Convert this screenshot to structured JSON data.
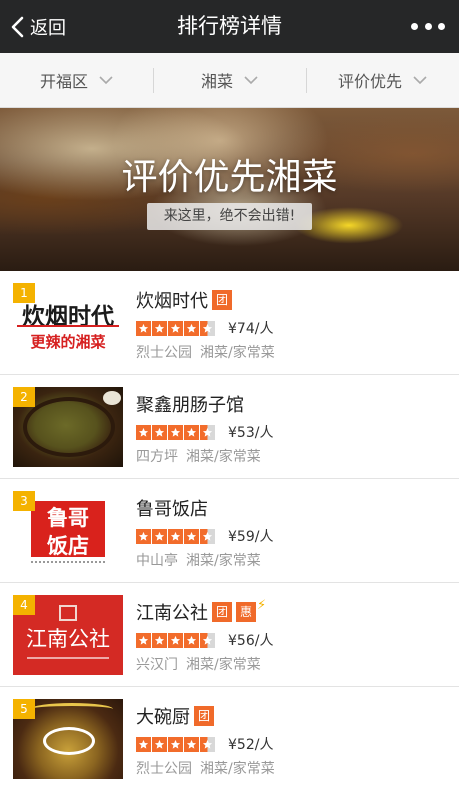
{
  "nav": {
    "back_label": "返回",
    "title": "排行榜详情"
  },
  "filters": [
    {
      "label": "开福区"
    },
    {
      "label": "湘菜"
    },
    {
      "label": "评价优先"
    }
  ],
  "banner": {
    "title": "评价优先湘菜",
    "subtitle": "来这里，绝不会出错!"
  },
  "restaurants": [
    {
      "rank": "1",
      "name": "炊烟时代",
      "tags": [
        "团"
      ],
      "rating": 4.5,
      "price": "¥74/人",
      "area": "烈士公园",
      "category": "湘菜/家常菜",
      "logo_text": [
        "炊烟时代",
        "更辣的湘菜"
      ]
    },
    {
      "rank": "2",
      "name": "聚鑫朋肠子馆",
      "tags": [],
      "rating": 4.5,
      "price": "¥53/人",
      "area": "四方坪",
      "category": "湘菜/家常菜",
      "logo_text": []
    },
    {
      "rank": "3",
      "name": "鲁哥饭店",
      "tags": [],
      "rating": 4.5,
      "price": "¥59/人",
      "area": "中山亭",
      "category": "湘菜/家常菜",
      "logo_text": [
        "鲁哥",
        "饭店"
      ]
    },
    {
      "rank": "4",
      "name": "江南公社",
      "tags": [
        "团",
        "惠"
      ],
      "rating": 4.5,
      "price": "¥56/人",
      "area": "兴汉门",
      "category": "湘菜/家常菜",
      "logo_text": [
        "江南公社"
      ]
    },
    {
      "rank": "5",
      "name": "大碗厨",
      "tags": [
        "团"
      ],
      "rating": 4.5,
      "price": "¥52/人",
      "area": "烈士公园",
      "category": "湘菜/家常菜",
      "logo_text": [
        "大碗厨"
      ]
    }
  ],
  "colors": {
    "nav_bg": "#262728",
    "tag_orange": "#f06a2a",
    "star_orange": "#f26c2b",
    "rank_gold": "#f4b200"
  }
}
